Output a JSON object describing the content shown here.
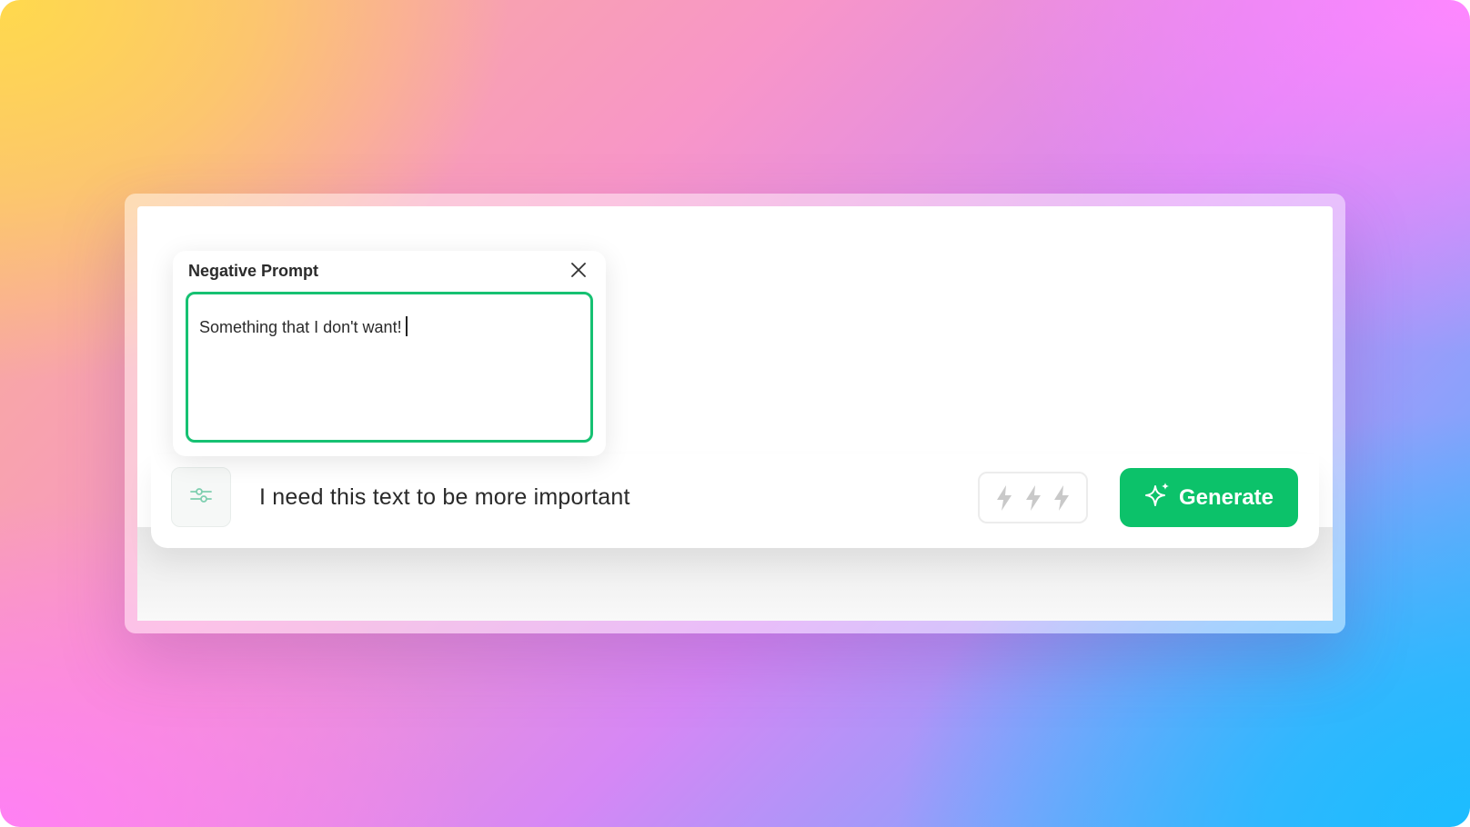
{
  "negative_prompt": {
    "title": "Negative Prompt",
    "value": "Something that I don't want!",
    "close_icon": "close-icon"
  },
  "prompt_bar": {
    "settings_icon": "sliders-icon",
    "text": "I need this text to be more important",
    "bolt_icons": [
      "lightning-icon",
      "lightning-icon",
      "lightning-icon"
    ],
    "generate_label": "Generate",
    "generate_icon": "sparkle-icon"
  },
  "colors": {
    "accent": "#0cc26a",
    "input_border": "#16c172",
    "bolt_inactive": "#c9c9c9"
  }
}
